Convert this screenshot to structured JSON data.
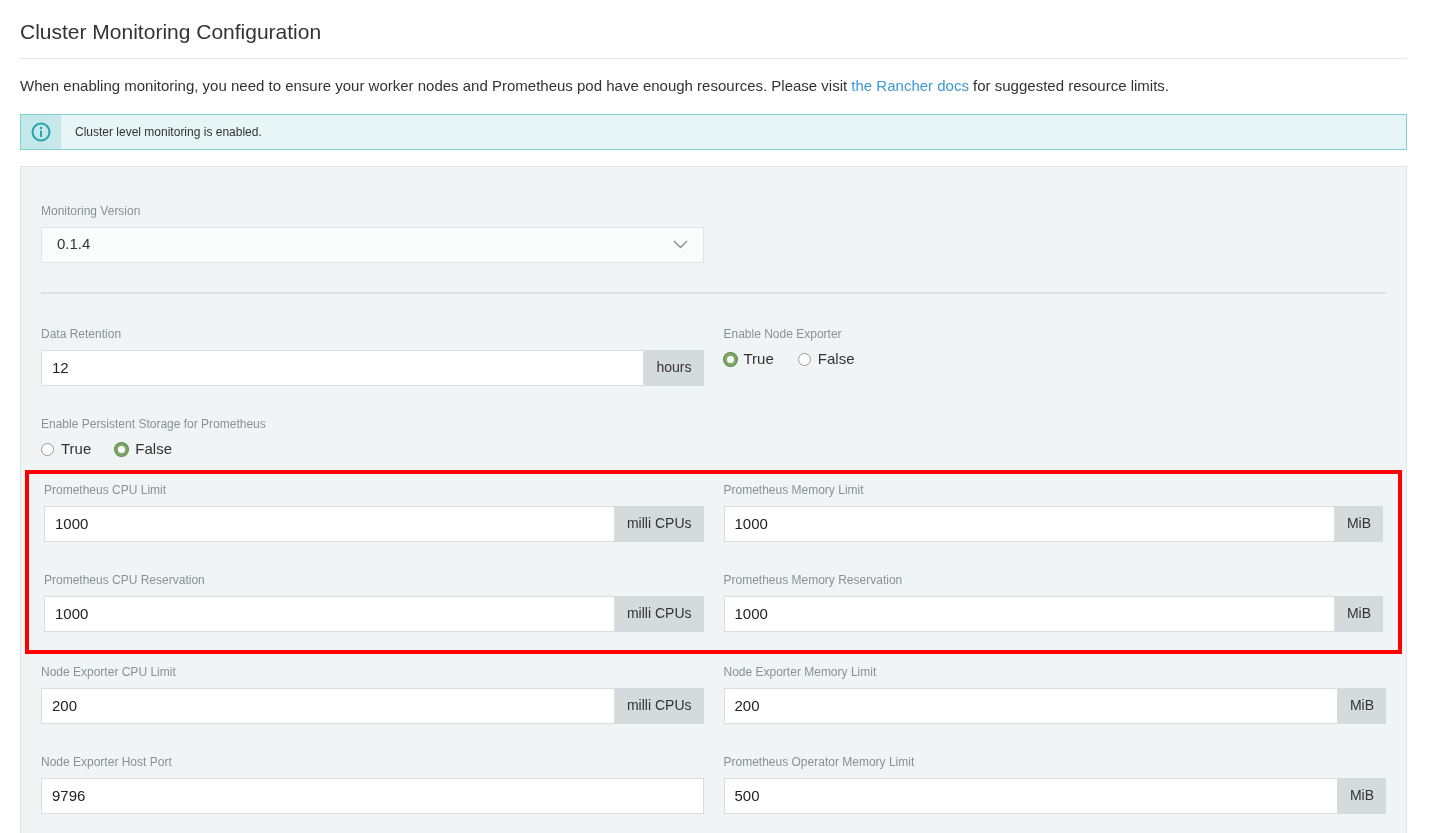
{
  "title": "Cluster Monitoring Configuration",
  "intro": {
    "before": "When enabling monitoring, you need to ensure your worker nodes and Prometheus pod have enough resources. Please visit ",
    "link": "the Rancher docs",
    "after": " for suggested resource limits."
  },
  "alert": {
    "kind": "info",
    "text": "Cluster level monitoring is enabled."
  },
  "version": {
    "label": "Monitoring Version",
    "value": "0.1.4"
  },
  "groups": [
    {
      "highlighted": false,
      "rows": [
        [
          {
            "kind": "input",
            "label": "Data Retention",
            "value": "12",
            "addon": "hours"
          },
          {
            "kind": "radio",
            "label": "Enable Node Exporter",
            "options": [
              {
                "label": "True",
                "selected": true
              },
              {
                "label": "False",
                "selected": false
              }
            ]
          }
        ],
        [
          {
            "kind": "radio",
            "label": "Enable Persistent Storage for Prometheus",
            "options": [
              {
                "label": "True",
                "selected": false
              },
              {
                "label": "False",
                "selected": true
              }
            ]
          }
        ]
      ]
    },
    {
      "highlighted": true,
      "rows": [
        [
          {
            "kind": "input",
            "label": "Prometheus CPU Limit",
            "value": "1000",
            "addon": "milli CPUs"
          },
          {
            "kind": "input",
            "label": "Prometheus Memory Limit",
            "value": "1000",
            "addon": "MiB"
          }
        ],
        [
          {
            "kind": "input",
            "label": "Prometheus CPU Reservation",
            "value": "1000",
            "addon": "milli CPUs"
          },
          {
            "kind": "input",
            "label": "Prometheus Memory Reservation",
            "value": "1000",
            "addon": "MiB"
          }
        ]
      ]
    },
    {
      "highlighted": false,
      "rows": [
        [
          {
            "kind": "input",
            "label": "Node Exporter CPU Limit",
            "value": "200",
            "addon": "milli CPUs"
          },
          {
            "kind": "input",
            "label": "Node Exporter Memory Limit",
            "value": "200",
            "addon": "MiB"
          }
        ],
        [
          {
            "kind": "input",
            "label": "Node Exporter Host Port",
            "value": "9796"
          },
          {
            "kind": "input",
            "label": "Prometheus Operator Memory Limit",
            "value": "500",
            "addon": "MiB"
          }
        ]
      ]
    }
  ]
}
